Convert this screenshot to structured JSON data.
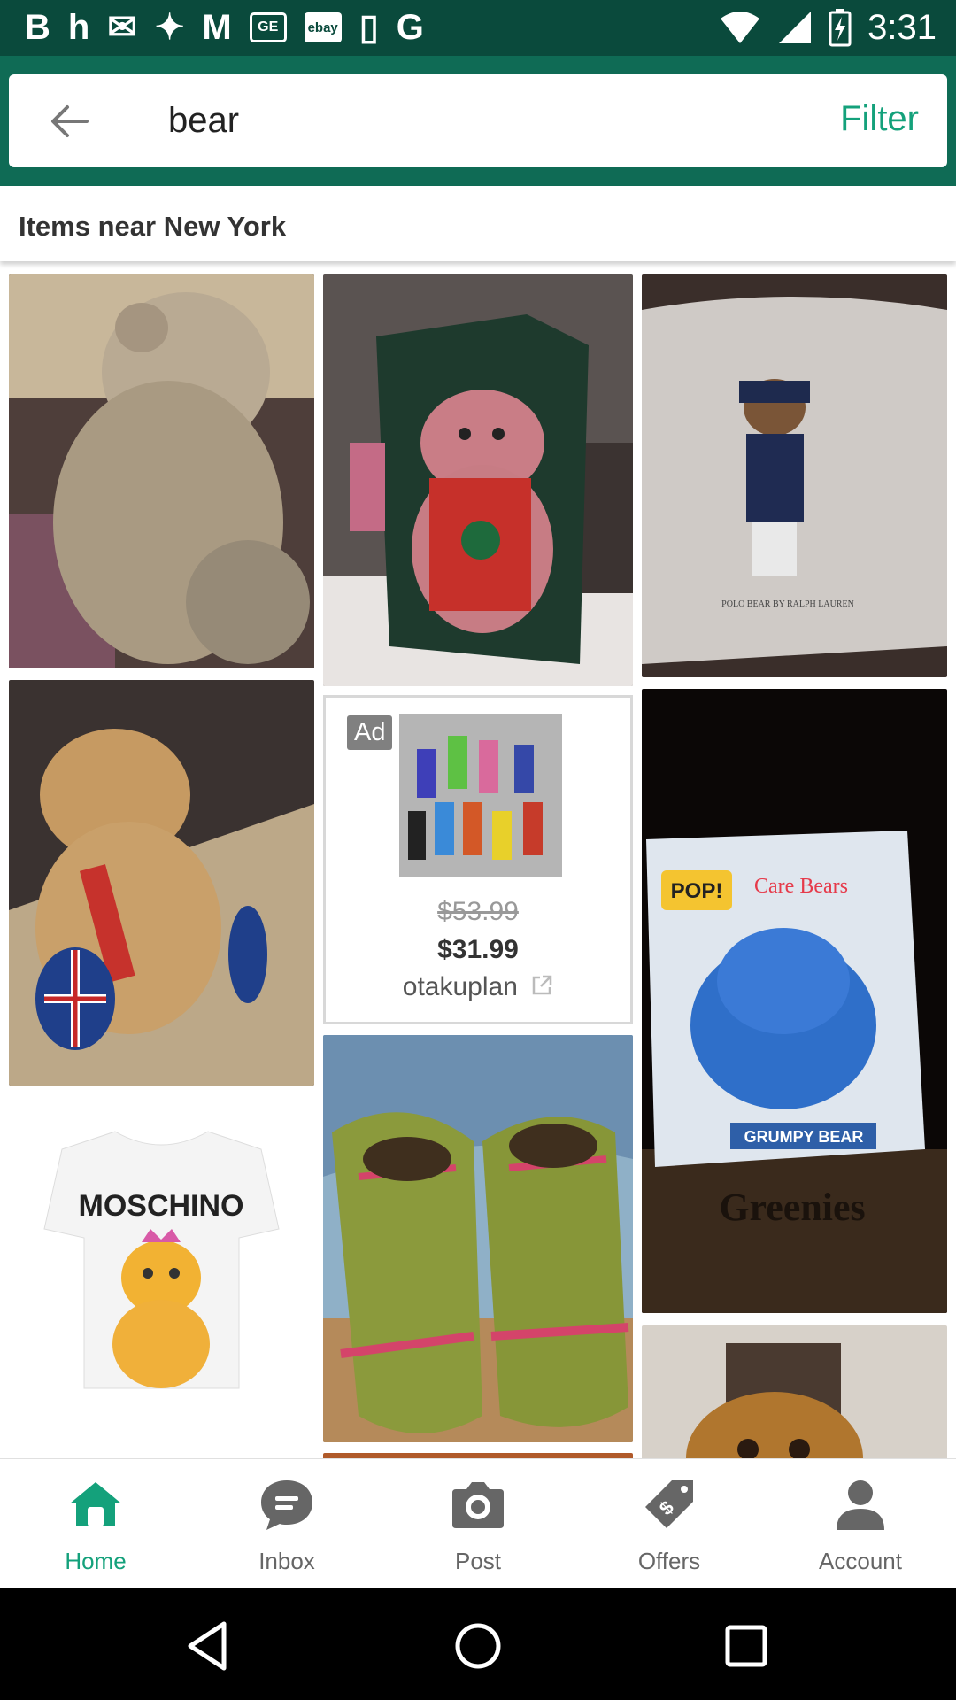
{
  "status_bar": {
    "time": "3:31",
    "left_icons": [
      "B",
      "h",
      "✉",
      "✦",
      "M",
      "GE",
      "ebay",
      "▯",
      "G"
    ]
  },
  "search": {
    "query": "bear",
    "filter_label": "Filter"
  },
  "location": {
    "text": "Items near New York"
  },
  "ad": {
    "badge": "Ad",
    "old_price": "$53.99",
    "price": "$31.99",
    "seller": "otakuplan"
  },
  "nav": {
    "items": [
      {
        "label": "Home",
        "icon": "home-icon",
        "active": true
      },
      {
        "label": "Inbox",
        "icon": "chat-icon",
        "active": false
      },
      {
        "label": "Post",
        "icon": "camera-icon",
        "active": false
      },
      {
        "label": "Offers",
        "icon": "offer-tag-icon",
        "active": false
      },
      {
        "label": "Account",
        "icon": "account-icon",
        "active": false
      }
    ]
  },
  "colors": {
    "header": "#0f6b55",
    "status_bar": "#0a4a3c",
    "accent": "#14a17b"
  }
}
